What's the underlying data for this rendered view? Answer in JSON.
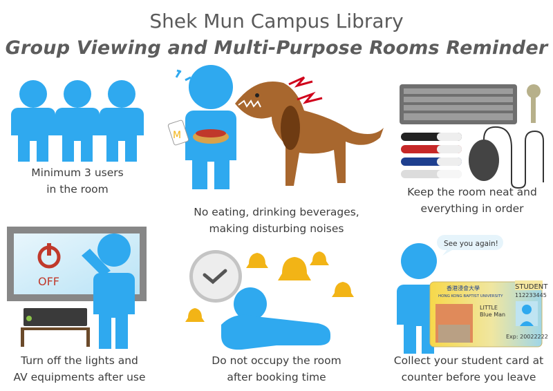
{
  "header": {
    "title": "Shek Mun Campus Library",
    "subtitle": "Group Viewing and Multi-Purpose Rooms Reminder"
  },
  "rules": [
    {
      "icon": "three-users-icon",
      "line1": "Minimum 3 users",
      "line2": "in the room"
    },
    {
      "icon": "no-eating-dog-icon",
      "line1": "No eating, drinking beverages,",
      "line2": "making disturbing noises"
    },
    {
      "icon": "keyboard-markers-mouse-key-icon",
      "line1": "Keep the room neat and",
      "line2": "everything in order"
    },
    {
      "icon": "power-off-screen-icon",
      "line1": "Turn off the lights and",
      "line2": "AV equipments after use"
    },
    {
      "icon": "clock-bells-icon",
      "line1": "Do not occupy the room",
      "line2": "after booking time"
    },
    {
      "icon": "student-card-icon",
      "line1": "Collect your student card at",
      "line2": "counter before you leave"
    }
  ],
  "screen": {
    "off_label": "OFF"
  },
  "speech_bubble": "See you again!",
  "student_card": {
    "header": "STUDENT",
    "number": "112233445",
    "university_cn": "香港浸會大學",
    "university_en": "HONG KONG BAPTIST UNIVERSITY",
    "name_line1": "LITTLE",
    "name_line2": "Blue Man",
    "expiry": "Exp: 20022222"
  },
  "colors": {
    "figure_blue": "#2fa9ef",
    "dog_brown": "#a8672e",
    "bell_gold": "#f2b416",
    "power_red": "#c0392b"
  }
}
